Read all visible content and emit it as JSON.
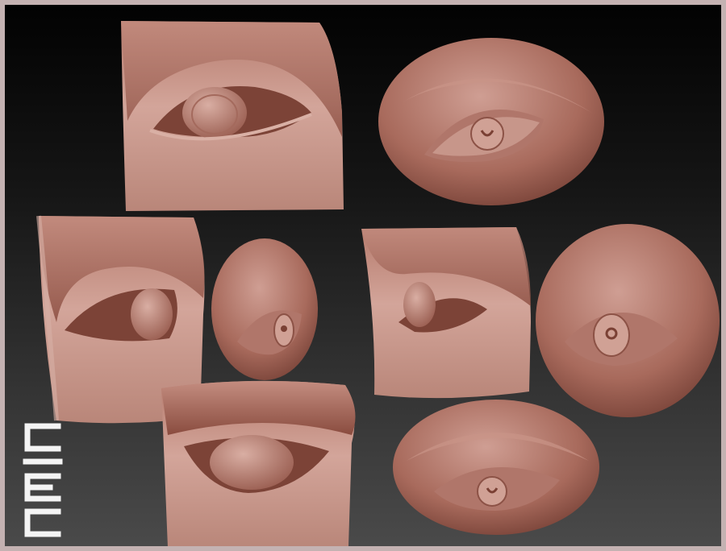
{
  "scene": {
    "subject": "clay-eye-sculpt-views",
    "colors": {
      "frame": "#c4b2b2",
      "background_top": "#020202",
      "background_bottom": "#4a4a4a",
      "clay_light": "#cf9e93",
      "clay_mid": "#b57a6c",
      "clay_dark": "#6e3a30",
      "logo": "#f4f4f4"
    },
    "views": [
      "front-block-view",
      "oval-front-view",
      "side-block-view",
      "profile-oval-view",
      "underside-block-view",
      "three-quarter-block-view",
      "three-quarter-oval-view",
      "low-oval-view"
    ]
  },
  "logo": {
    "icon": "ciel-logo-icon"
  }
}
